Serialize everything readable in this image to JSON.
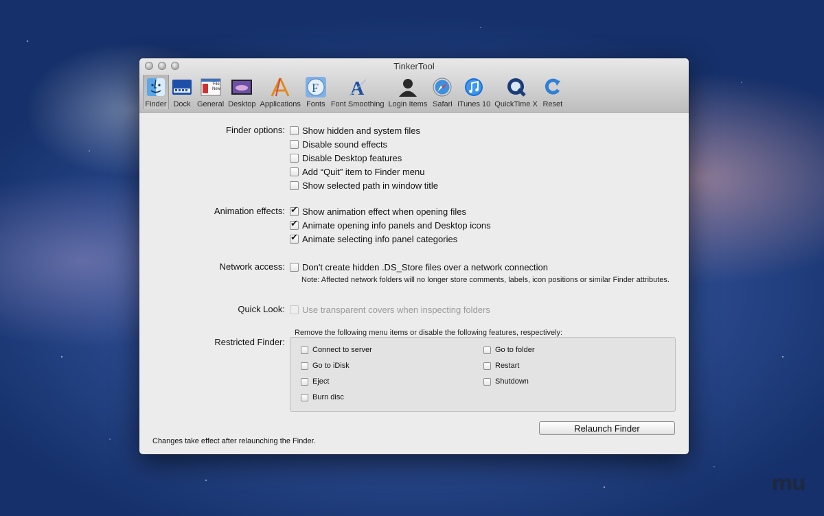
{
  "window": {
    "title": "TinkerTool"
  },
  "toolbar": {
    "items": [
      {
        "label": "Finder",
        "icon": "finder-icon",
        "selected": true
      },
      {
        "label": "Dock",
        "icon": "dock-icon"
      },
      {
        "label": "General",
        "icon": "general-icon"
      },
      {
        "label": "Desktop",
        "icon": "desktop-icon"
      },
      {
        "label": "Applications",
        "icon": "applications-icon"
      },
      {
        "label": "Fonts",
        "icon": "fonts-icon"
      },
      {
        "label": "Font Smoothing",
        "icon": "font-smoothing-icon"
      },
      {
        "label": "Login Items",
        "icon": "login-items-icon"
      },
      {
        "label": "Safari",
        "icon": "safari-icon"
      },
      {
        "label": "iTunes 10",
        "icon": "itunes-icon"
      },
      {
        "label": "QuickTime X",
        "icon": "quicktime-icon"
      },
      {
        "label": "Reset",
        "icon": "reset-icon"
      }
    ]
  },
  "finder_options": {
    "label": "Finder options:",
    "items": [
      {
        "label": "Show hidden and system files",
        "checked": false
      },
      {
        "label": "Disable sound effects",
        "checked": false
      },
      {
        "label": "Disable Desktop features",
        "checked": false
      },
      {
        "label": "Add “Quit” item to Finder menu",
        "checked": false
      },
      {
        "label": "Show selected path in window title",
        "checked": false
      }
    ]
  },
  "animation_effects": {
    "label": "Animation effects:",
    "items": [
      {
        "label": "Show animation effect when opening files",
        "checked": true
      },
      {
        "label": "Animate opening info panels and Desktop icons",
        "checked": true
      },
      {
        "label": "Animate selecting info panel categories",
        "checked": true
      }
    ]
  },
  "network_access": {
    "label": "Network access:",
    "item": {
      "label": "Don't create hidden .DS_Store files over a network connection",
      "checked": false
    },
    "note": "Note: Affected network folders will no longer store comments, labels, icon positions or similar Finder attributes."
  },
  "quick_look": {
    "label": "Quick Look:",
    "item": {
      "label": "Use transparent covers when inspecting folders",
      "checked": false,
      "disabled": true
    }
  },
  "restricted_finder": {
    "label": "Restricted Finder:",
    "description": "Remove the following menu items or disable the following features, respectively:",
    "left": [
      "Connect to server",
      "Go to iDisk",
      "Eject",
      "Burn disc"
    ],
    "right": [
      "Go to folder",
      "Restart",
      "Shutdown"
    ]
  },
  "relaunch_button": "Relaunch Finder",
  "footer": "Changes take effect after relaunching the Finder."
}
